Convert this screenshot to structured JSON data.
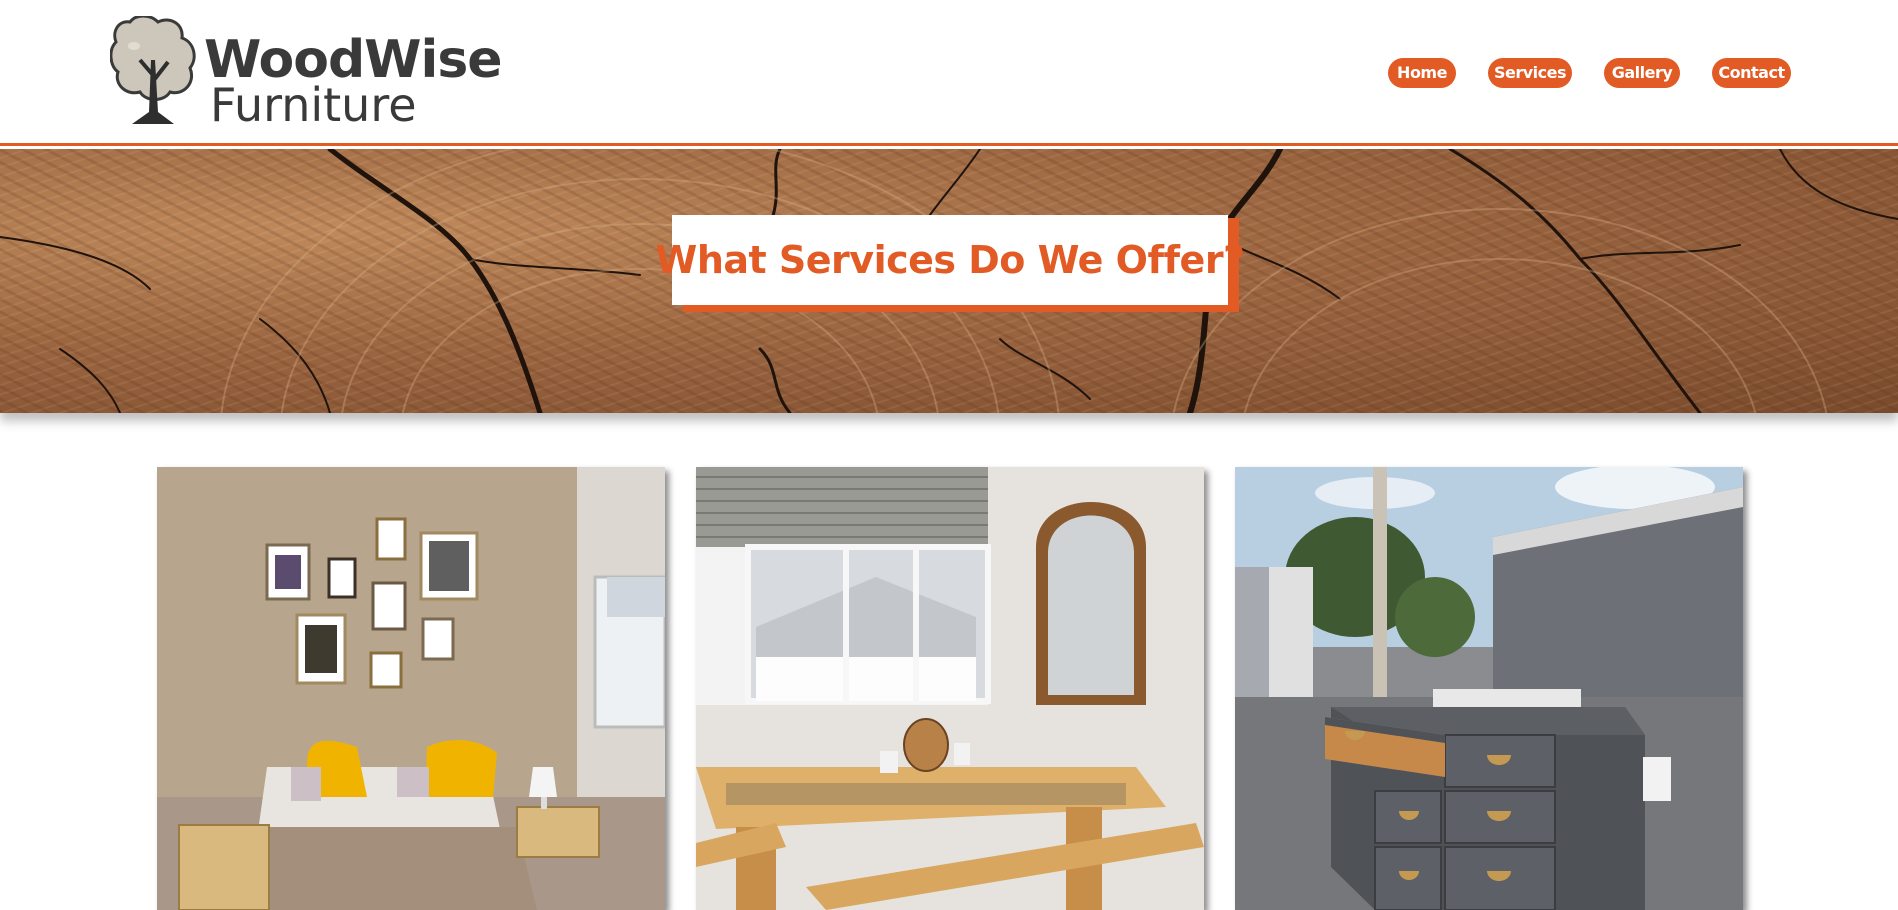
{
  "header": {
    "logo": {
      "line1": "WoodWise",
      "line2": "Furniture"
    },
    "nav": [
      {
        "label": "Home"
      },
      {
        "label": "Services"
      },
      {
        "label": "Gallery"
      },
      {
        "label": "Contact"
      }
    ]
  },
  "hero": {
    "title": "What Services Do We Offer?"
  },
  "colors": {
    "accent": "#e25a24",
    "text_dark": "#3a3a3a"
  },
  "gallery": {
    "photos": [
      {
        "icon": "bedroom-photo"
      },
      {
        "icon": "dining-table-photo"
      },
      {
        "icon": "chest-of-drawers-photo"
      }
    ]
  }
}
